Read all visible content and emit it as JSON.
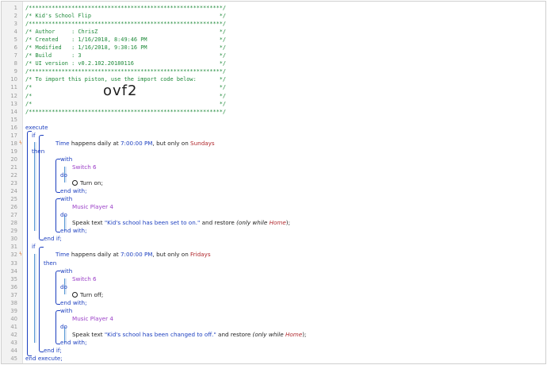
{
  "editor": {
    "header_lines": [
      "/***********************************************************/",
      "/* Kid's School Flip                                       */",
      "/***********************************************************/",
      "/* Author     : ChrisZ                                     */",
      "/* Created    : 1/16/2018, 8:49:46 PM                      */",
      "/* Modified   : 1/16/2018, 9:30:16 PM                      */",
      "/* Build      : 3                                          */",
      "/* UI version : v0.2.102.20180116                          */",
      "/***********************************************************/",
      "/* To import this piston, use the import code below:       */",
      "/*                                                         */",
      "/*                                                         */",
      "/*                                                         */",
      "/***********************************************************/"
    ],
    "import_code": "ovf2",
    "line_numbers": [
      "1",
      "2",
      "3",
      "4",
      "5",
      "6",
      "7",
      "8",
      "9",
      "10",
      "11",
      "12",
      "13",
      "14",
      "15",
      "16",
      "17",
      "18",
      "19",
      "20",
      "21",
      "22",
      "23",
      "24",
      "25",
      "26",
      "27",
      "28",
      "29",
      "30",
      "31",
      "32",
      "33",
      "34",
      "35",
      "36",
      "37",
      "38",
      "39",
      "40",
      "41",
      "42",
      "43",
      "44",
      "45"
    ],
    "marker_icon": "restriction-marker-icon",
    "power_icon": "power-icon",
    "keywords": {
      "execute": "execute",
      "if": "if",
      "then": "then",
      "with": "with",
      "do": "do",
      "end_with": "end with;",
      "end_if": "end if;",
      "end_execute": "end execute;"
    },
    "if1": {
      "subject": "Time",
      "text1": " happens daily at ",
      "time": "7:00:00 PM",
      "text2": ", but only on ",
      "days": "Sundays"
    },
    "if2": {
      "subject": "Time",
      "text1": " happens daily at ",
      "time": "7:00:00 PM",
      "text2": ", but only on ",
      "days": "Fridays"
    },
    "device_switch": "Switch 6",
    "device_player": "Music Player 4",
    "action_on": "Turn on;",
    "action_off": "Turn off;",
    "speak1": {
      "pre": "Speak text ",
      "text": "\"Kid's school has been set to on.\"",
      "mid": " and restore ",
      "paren_open": "(only while ",
      "mode": "Home",
      "paren_close": ");"
    },
    "speak2": {
      "pre": "Speak text ",
      "text": "\"Kid's school has been changed to off.\"",
      "mid": " and restore ",
      "paren_open": "(only while ",
      "mode": "Home",
      "paren_close": ");"
    }
  }
}
